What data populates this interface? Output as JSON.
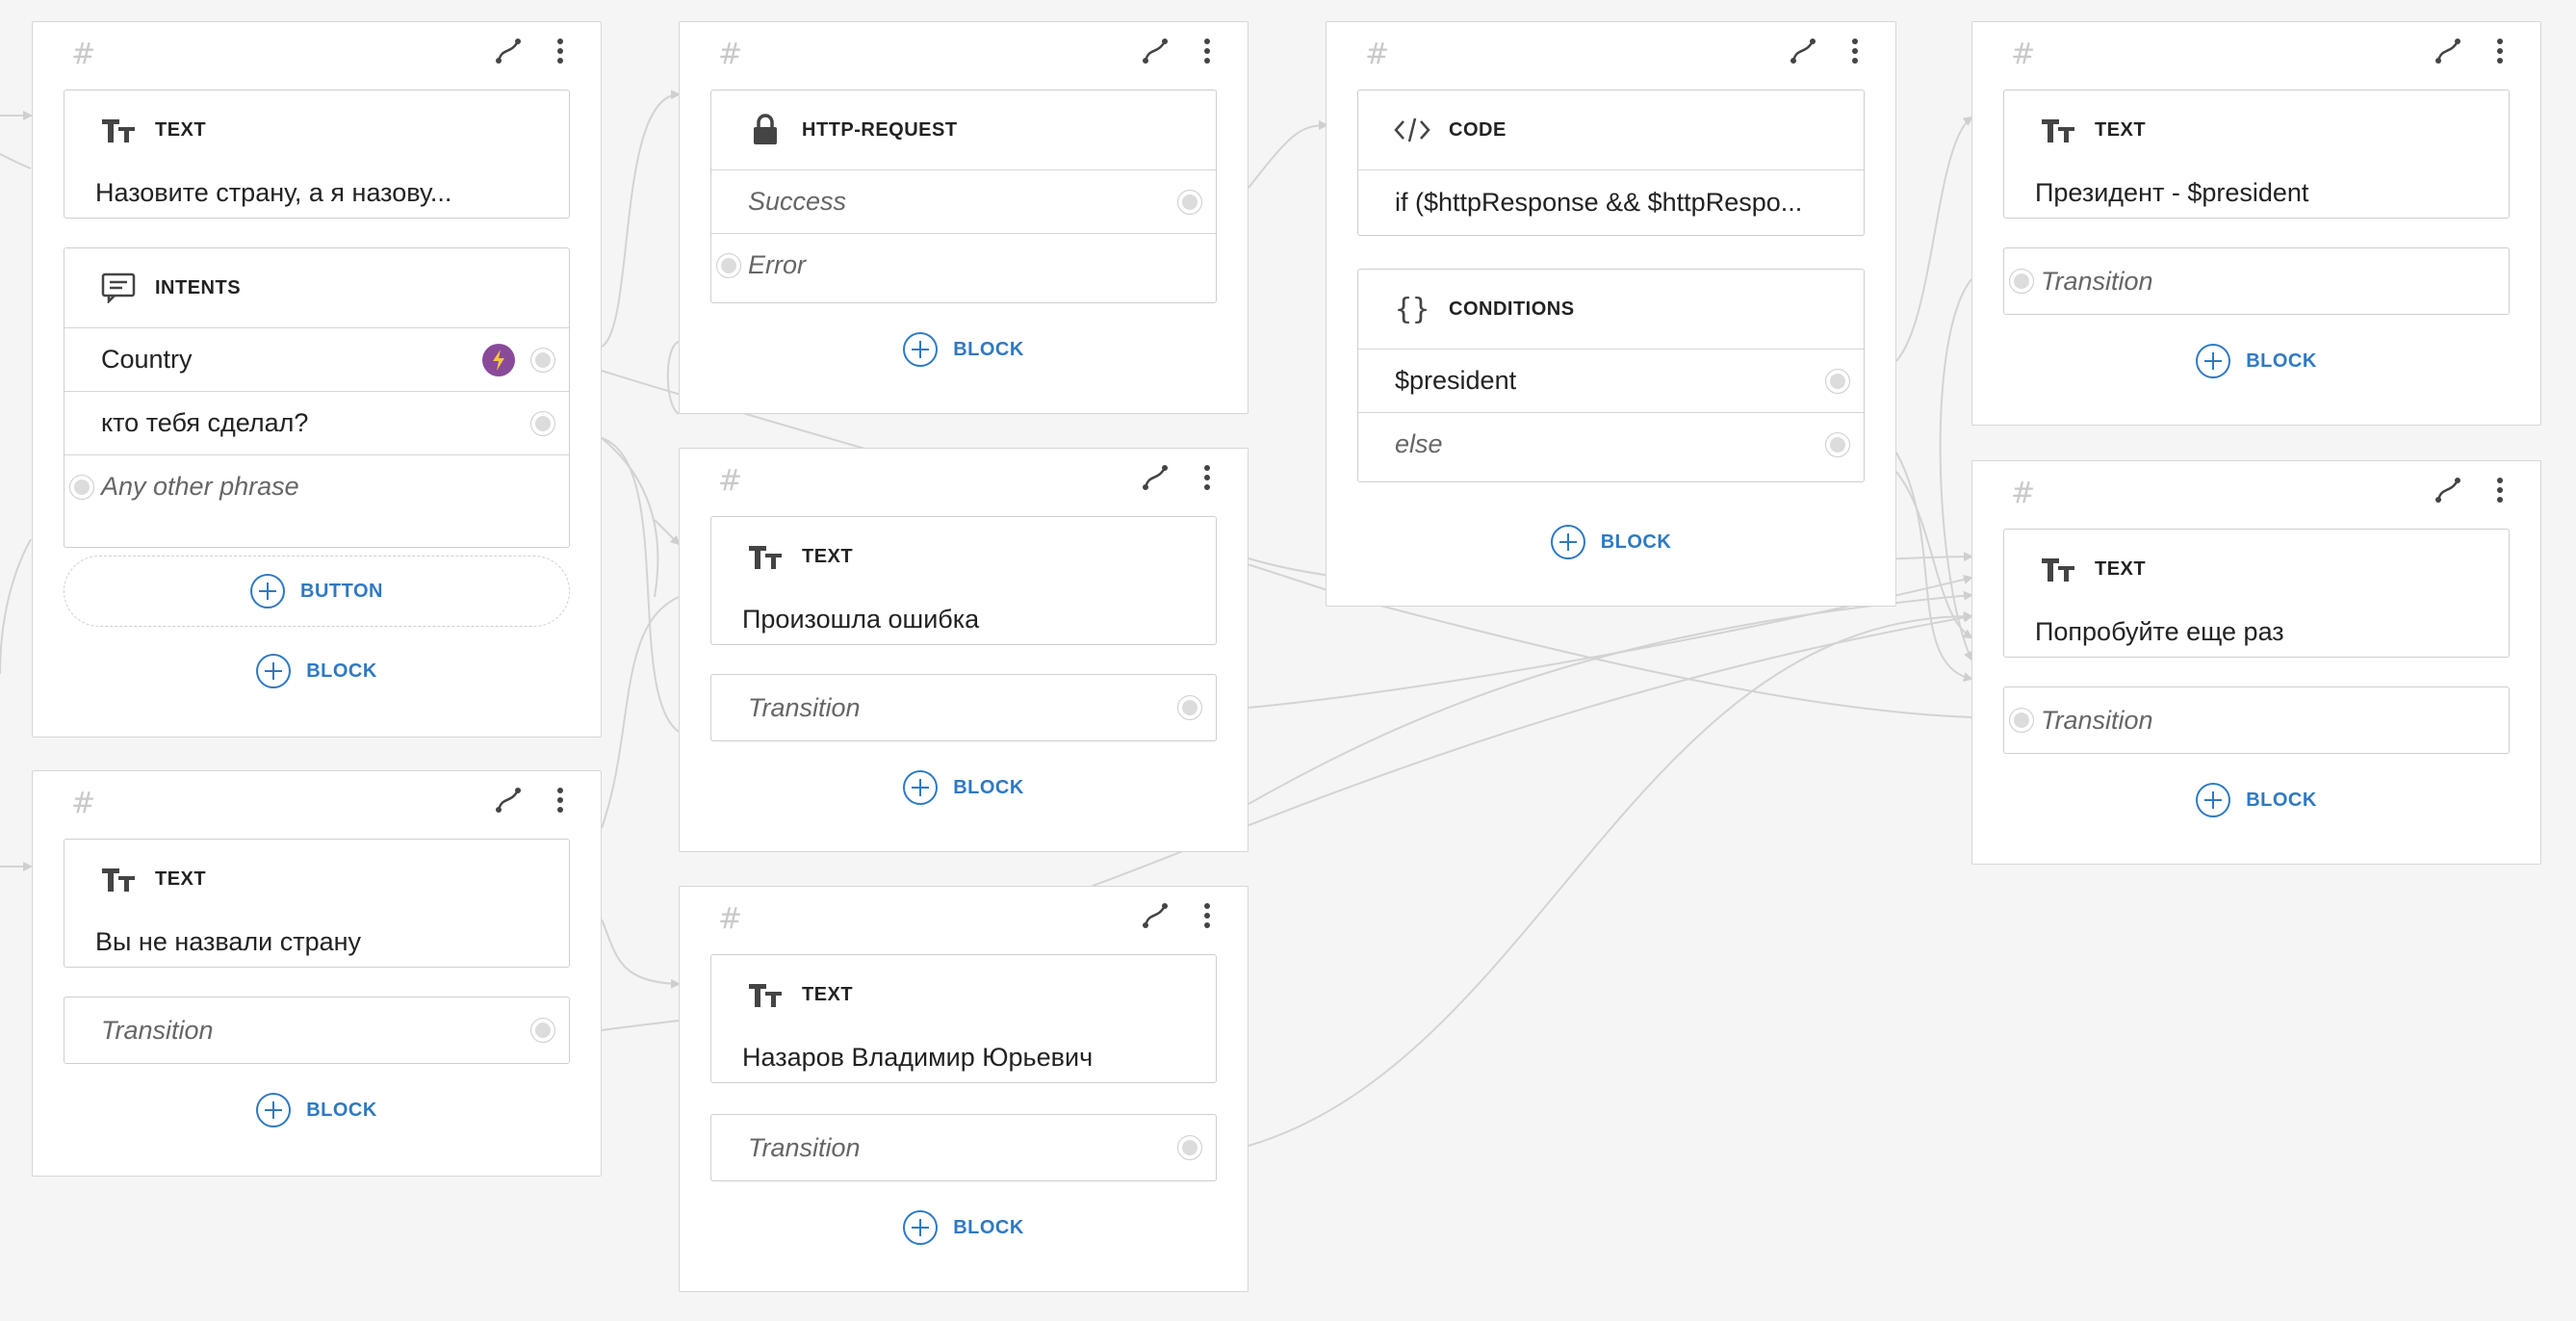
{
  "common": {
    "hash": "#",
    "type_text": "TEXT",
    "type_intents": "INTENTS",
    "type_http": "HTTP-REQUEST",
    "type_code": "CODE",
    "type_conditions": "CONDITIONS",
    "add_block": "BLOCK",
    "add_button": "BUTTON",
    "transition": "Transition"
  },
  "screens": {
    "start": {
      "text": "Назовите страну, а я назову...",
      "intents": [
        {
          "label": "Country"
        },
        {
          "label": "кто тебя сделал?"
        }
      ],
      "fallback": "Any other phrase"
    },
    "http": {
      "success": "Success",
      "error": "Error"
    },
    "code": {
      "code": "if ($httpResponse && $httpRespo...",
      "cond_president": "$president",
      "cond_else": "else"
    },
    "president": {
      "text": "Президент - $president"
    },
    "error": {
      "text": "Произошла ошибка"
    },
    "retry": {
      "text": "Попробуйте еще раз"
    },
    "no_country": {
      "text": "Вы не назвали страну"
    },
    "creator": {
      "text": "Назаров Владимир Юрьевич"
    }
  },
  "colors": {
    "accent": "#2f79c2",
    "bolt": "#8a4a9a",
    "wire": "#d0d0d0",
    "canvas": "#f5f5f5"
  }
}
